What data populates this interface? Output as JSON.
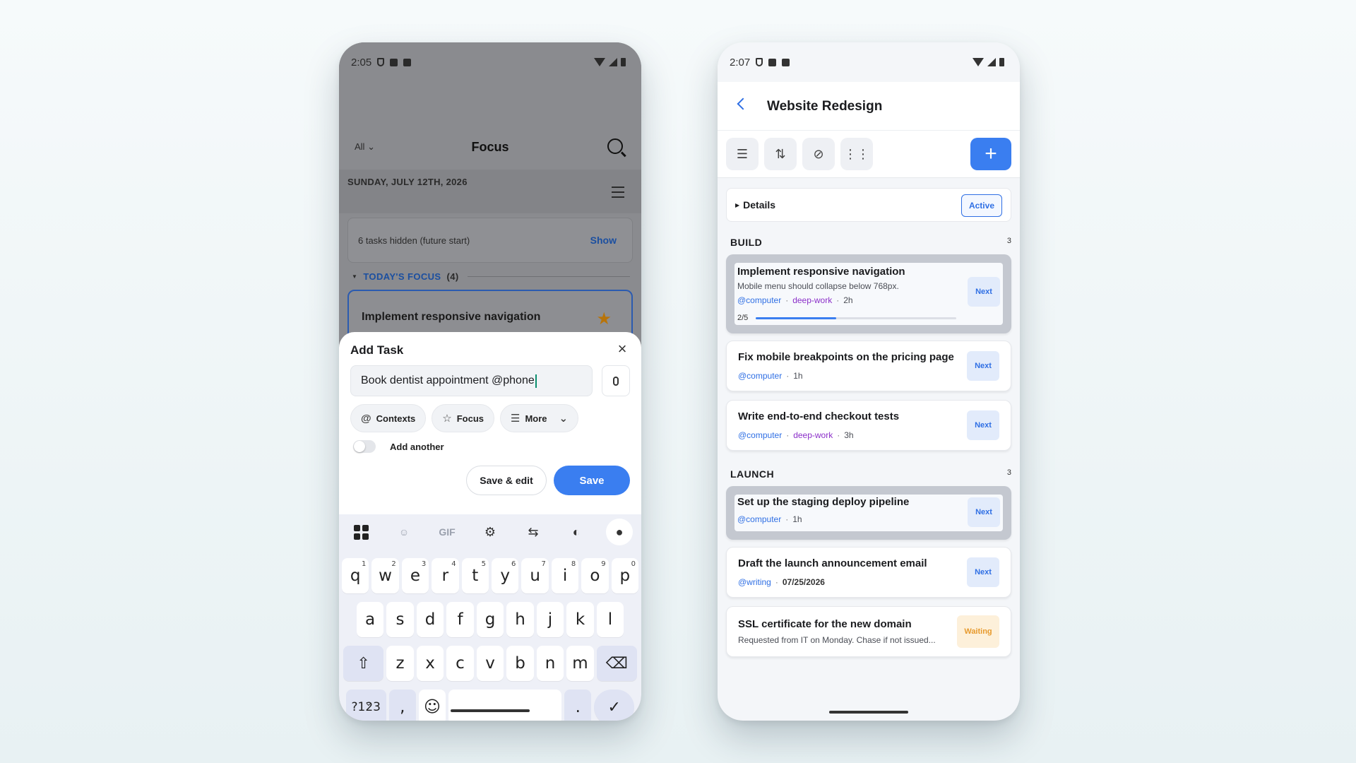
{
  "left": {
    "status": {
      "time": "2:05"
    },
    "app": {
      "filter": "All",
      "title": "Focus",
      "date": "SUNDAY, JULY 12TH, 2026",
      "hidden_text": "6 tasks hidden (future start)",
      "hidden_action": "Show",
      "focus_section": "TODAY'S FOCUS",
      "focus_count": "(4)",
      "focus_task": "Implement responsive navigation"
    },
    "sheet": {
      "title": "Add Task",
      "input_value": "Book dentist appointment @phone",
      "chips": {
        "contexts": "Contexts",
        "focus": "Focus",
        "more": "More"
      },
      "add_another": "Add another",
      "add_another_on": false,
      "save_edit": "Save & edit",
      "save": "Save"
    },
    "keyboard": {
      "gif": "GIF",
      "row1": [
        [
          "q",
          "1"
        ],
        [
          "w",
          "2"
        ],
        [
          "e",
          "3"
        ],
        [
          "r",
          "4"
        ],
        [
          "t",
          "5"
        ],
        [
          "y",
          "6"
        ],
        [
          "u",
          "7"
        ],
        [
          "i",
          "8"
        ],
        [
          "o",
          "9"
        ],
        [
          "p",
          "0"
        ]
      ],
      "row2": [
        "a",
        "s",
        "d",
        "f",
        "g",
        "h",
        "j",
        "k",
        "l"
      ],
      "row3": [
        "z",
        "x",
        "c",
        "v",
        "b",
        "n",
        "m"
      ],
      "num_key": "?123",
      "comma": ",",
      "period": "."
    }
  },
  "right": {
    "status": {
      "time": "2:07"
    },
    "title": "Website Redesign",
    "details_label": "Details",
    "status_badge": "Active",
    "sections": [
      {
        "name": "BUILD",
        "count": "3",
        "tasks": [
          {
            "title": "Implement responsive navigation",
            "desc": "Mobile menu should collapse below 768px.",
            "context": "@computer",
            "tag": "deep-work",
            "duration": "2h",
            "progress_label": "2/5",
            "progress": 0.4,
            "badge": "Next"
          },
          {
            "title": "Fix mobile breakpoints on the pricing page",
            "context": "@computer",
            "duration": "1h",
            "badge": "Next"
          },
          {
            "title": "Write end-to-end checkout tests",
            "context": "@computer",
            "tag": "deep-work",
            "duration": "3h",
            "badge": "Next"
          }
        ]
      },
      {
        "name": "LAUNCH",
        "count": "3",
        "tasks": [
          {
            "title": "Set up the staging deploy pipeline",
            "context": "@computer",
            "duration": "1h",
            "badge": "Next"
          },
          {
            "title": "Draft the launch announcement email",
            "context": "@writing",
            "date": "07/25/2026",
            "badge": "Next"
          },
          {
            "title": "SSL certificate for the new domain",
            "desc": "Requested from IT on Monday. Chase if not issued...",
            "badge": "Waiting"
          }
        ]
      }
    ]
  },
  "colors": {
    "accent": "#3a7ef0",
    "tag": "#8b2fc9",
    "waiting": "#e79a2d",
    "focus_border": "#2b5bb0"
  }
}
